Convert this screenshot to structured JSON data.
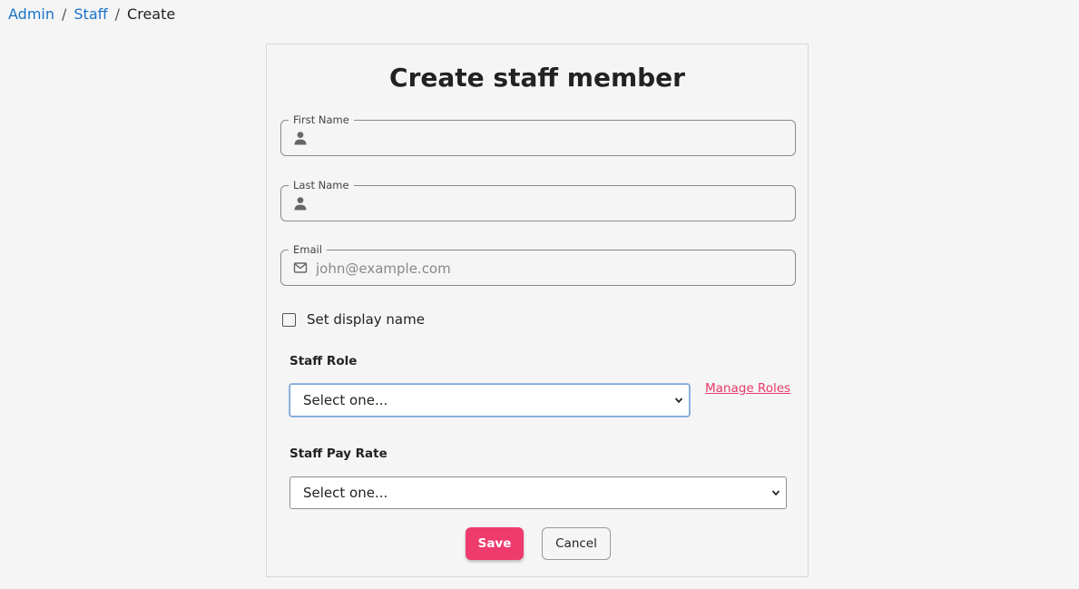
{
  "breadcrumb": {
    "items": [
      "Admin",
      "Staff"
    ],
    "separator": "/",
    "current": "Create"
  },
  "form": {
    "title": "Create staff member",
    "first_name": {
      "label": "First Name",
      "value": "",
      "placeholder": "",
      "icon": "person-icon"
    },
    "last_name": {
      "label": "Last Name",
      "value": "",
      "placeholder": "",
      "icon": "person-icon"
    },
    "email": {
      "label": "Email",
      "value": "",
      "placeholder": "john@example.com",
      "icon": "mail-icon"
    },
    "display_name_checkbox": {
      "label": "Set display name",
      "checked": false
    },
    "staff_role": {
      "label": "Staff Role",
      "selected": "Select one...",
      "manage_link": "Manage Roles"
    },
    "staff_pay_rate": {
      "label": "Staff Pay Rate",
      "selected": "Select one..."
    },
    "save_label": "Save",
    "cancel_label": "Cancel"
  },
  "colors": {
    "link": "#1a73c9",
    "accent": "#ee3a6c",
    "background": "#f5f5f5"
  }
}
